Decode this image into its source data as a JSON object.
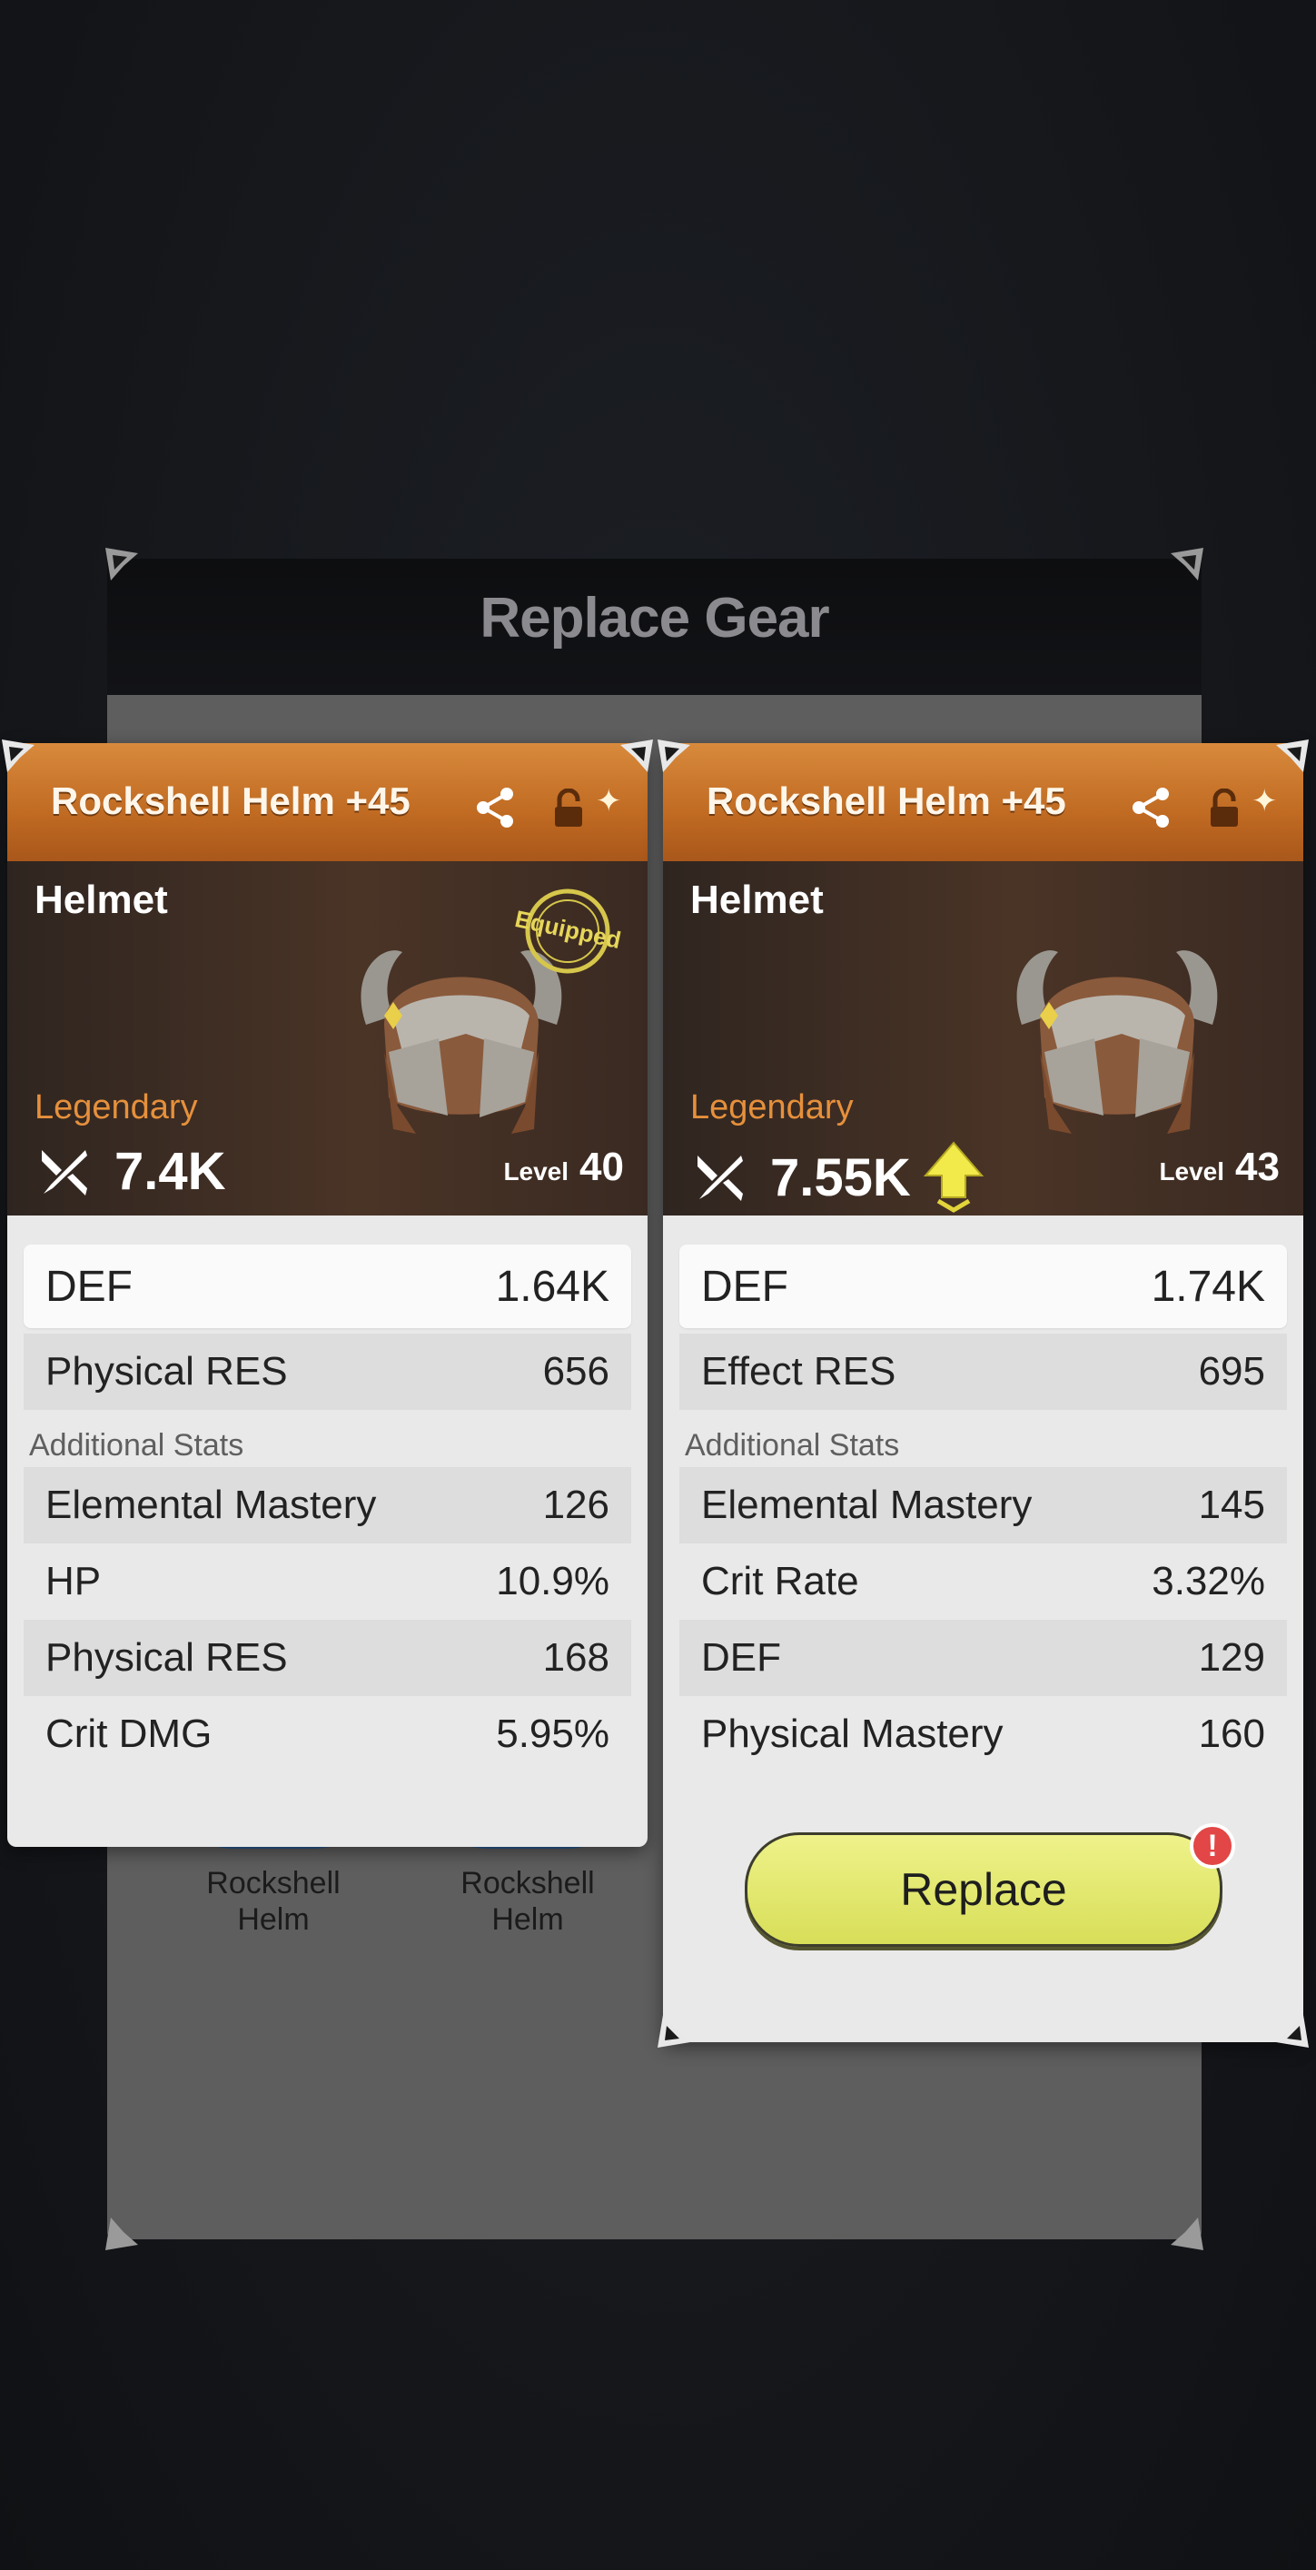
{
  "modal": {
    "title": "Replace Gear"
  },
  "background_items": [
    {
      "label_line1": "Rockshell",
      "label_line2": "Helm"
    },
    {
      "label_line1": "Rockshell",
      "label_line2": "Helm"
    }
  ],
  "left_card": {
    "name": "Rockshell Helm +45",
    "type": "Helmet",
    "badge": "Equipped",
    "rarity": "Legendary",
    "power": "7.4K",
    "level_label": "Level",
    "level": "40",
    "main_stat": {
      "label": "DEF",
      "value": "1.64K"
    },
    "sub_stat": {
      "label": "Physical RES",
      "value": "656"
    },
    "additional_header": "Additional Stats",
    "additional": [
      {
        "label": "Elemental Mastery",
        "value": "126"
      },
      {
        "label": "HP",
        "value": "10.9%"
      },
      {
        "label": "Physical RES",
        "value": "168"
      },
      {
        "label": "Crit DMG",
        "value": "5.95%"
      }
    ]
  },
  "right_card": {
    "name": "Rockshell Helm +45",
    "type": "Helmet",
    "rarity": "Legendary",
    "power": "7.55K",
    "level_label": "Level",
    "level": "43",
    "main_stat": {
      "label": "DEF",
      "value": "1.74K"
    },
    "sub_stat": {
      "label": "Effect RES",
      "value": "695"
    },
    "additional_header": "Additional Stats",
    "additional": [
      {
        "label": "Elemental Mastery",
        "value": "145"
      },
      {
        "label": "Crit Rate",
        "value": "3.32%"
      },
      {
        "label": "DEF",
        "value": "129"
      },
      {
        "label": "Physical Mastery",
        "value": "160"
      }
    ],
    "replace_label": "Replace",
    "alert_mark": "!"
  },
  "colors": {
    "rarity": "#e6903c",
    "header_orange": "#c06a22",
    "replace_button": "#e2e86e",
    "alert": "#e24646"
  },
  "icons": [
    "share-icon",
    "lock-icon",
    "sparkle-icon",
    "power-icon",
    "upgrade-arrow-icon",
    "helmet-icon",
    "equipped-seal"
  ]
}
